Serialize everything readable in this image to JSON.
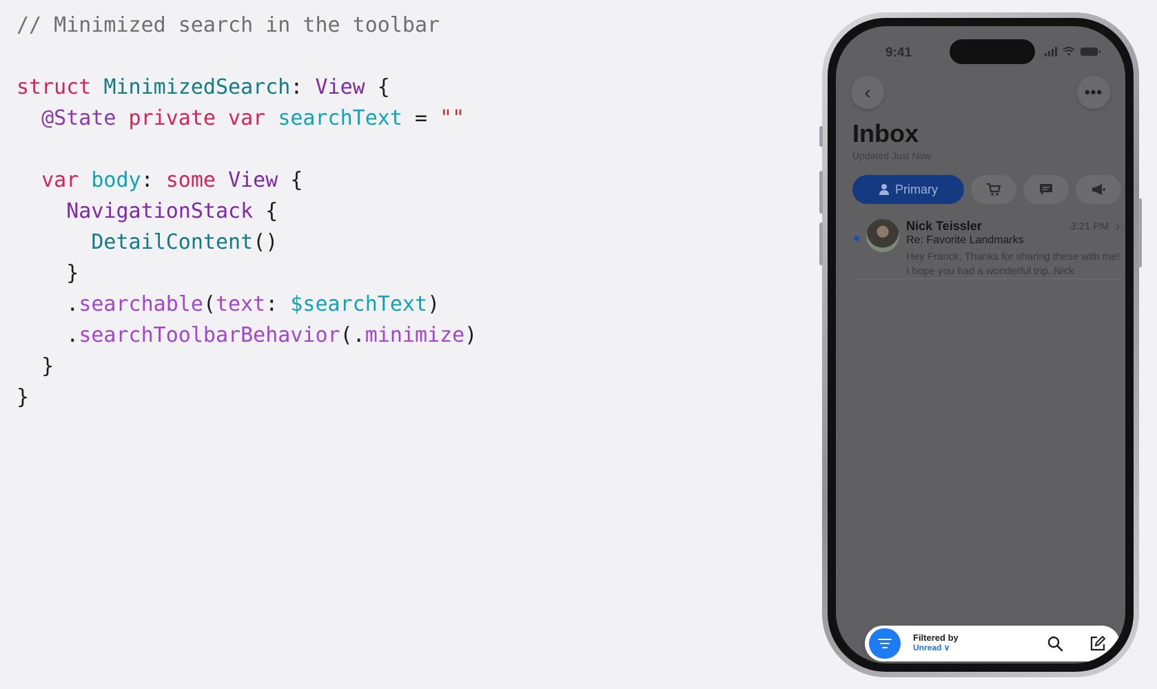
{
  "code": {
    "lines": [
      [
        {
          "t": "// Minimized search in the toolbar",
          "c": "comment"
        }
      ],
      [],
      [
        {
          "t": "struct ",
          "c": "kw"
        },
        {
          "t": "MinimizedSearch",
          "c": "type"
        },
        {
          "t": ": ",
          "c": "plain"
        },
        {
          "t": "View",
          "c": "proto"
        },
        {
          "t": " {",
          "c": "plain"
        }
      ],
      [
        {
          "t": "  ",
          "c": "plain"
        },
        {
          "t": "@State",
          "c": "attr"
        },
        {
          "t": " private var ",
          "c": "kw"
        },
        {
          "t": "searchText",
          "c": "var"
        },
        {
          "t": " = ",
          "c": "plain"
        },
        {
          "t": "\"\"",
          "c": "str"
        }
      ],
      [],
      [
        {
          "t": "  ",
          "c": "plain"
        },
        {
          "t": "var ",
          "c": "kw"
        },
        {
          "t": "body",
          "c": "var"
        },
        {
          "t": ": ",
          "c": "plain"
        },
        {
          "t": "some ",
          "c": "kw"
        },
        {
          "t": "View",
          "c": "proto"
        },
        {
          "t": " {",
          "c": "plain"
        }
      ],
      [
        {
          "t": "    ",
          "c": "plain"
        },
        {
          "t": "NavigationStack",
          "c": "proto"
        },
        {
          "t": " {",
          "c": "plain"
        }
      ],
      [
        {
          "t": "      ",
          "c": "plain"
        },
        {
          "t": "DetailContent",
          "c": "type"
        },
        {
          "t": "()",
          "c": "plain"
        }
      ],
      [
        {
          "t": "    }",
          "c": "plain"
        }
      ],
      [
        {
          "t": "    .",
          "c": "plain"
        },
        {
          "t": "searchable",
          "c": "mod"
        },
        {
          "t": "(",
          "c": "plain"
        },
        {
          "t": "text",
          "c": "mod"
        },
        {
          "t": ": ",
          "c": "plain"
        },
        {
          "t": "$searchText",
          "c": "var"
        },
        {
          "t": ")",
          "c": "plain"
        }
      ],
      [
        {
          "t": "    .",
          "c": "plain"
        },
        {
          "t": "searchToolbarBehavior",
          "c": "mod"
        },
        {
          "t": "(.",
          "c": "plain"
        },
        {
          "t": "minimize",
          "c": "mod"
        },
        {
          "t": ")",
          "c": "plain"
        }
      ],
      [
        {
          "t": "  }",
          "c": "plain"
        }
      ],
      [
        {
          "t": "}",
          "c": "plain"
        }
      ]
    ]
  },
  "phone": {
    "status": {
      "time": "9:41"
    },
    "nav": {
      "back_icon": "chevron-left-icon",
      "more_icon": "ellipsis-icon",
      "back_glyph": "‹",
      "more_glyph": "•••"
    },
    "header": {
      "title": "Inbox",
      "subtitle": "Updated Just Now"
    },
    "chips": {
      "primary_label": "Primary",
      "icons": [
        "person-icon",
        "cart-icon",
        "message-icon",
        "megaphone-icon"
      ]
    },
    "mail": {
      "sender": "Nick Teissler",
      "time": "3:21 PM",
      "subject": "Re: Favorite Landmarks",
      "preview": "Hey Franck, Thanks for sharing these with me! I hope you had a wonderful trip. Nick",
      "chevron": "›"
    },
    "toolbar": {
      "filter_label": "Filtered by",
      "filter_value": "Unread",
      "filter_caret": " ∨"
    }
  },
  "colors": {
    "background": "#f2f2f4",
    "screen_dim": "#606062",
    "primary_chip": "#153a82",
    "accent_blue": "#1b7cf3",
    "code_keyword": "#d5245a",
    "code_type": "#117c85",
    "code_proto": "#7d2aa8",
    "code_variable": "#0fa3b8",
    "code_string": "#d12f2f",
    "code_modifier": "#a445cf",
    "code_comment": "#6e6e73"
  }
}
